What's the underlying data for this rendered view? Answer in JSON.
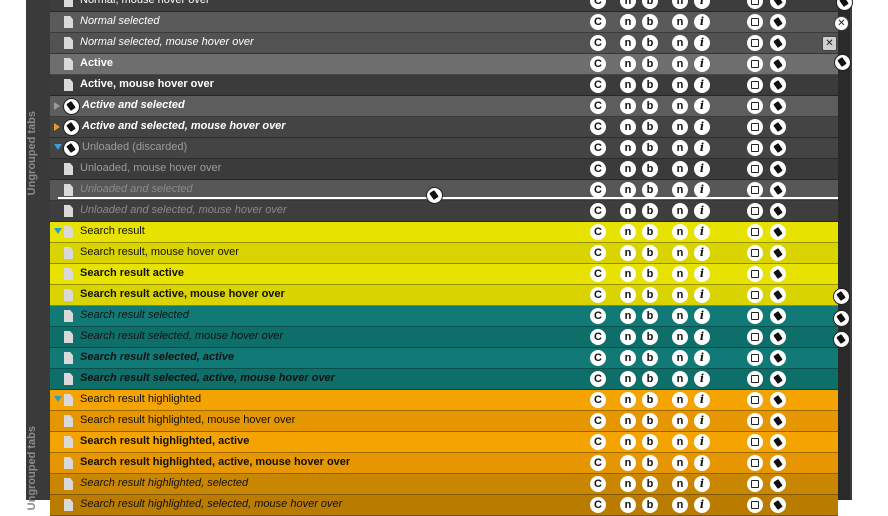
{
  "sidebar": {
    "top_label": "Ungrouped tabs",
    "bottom_label": "Ungrouped tabs"
  },
  "tab_icons": {
    "c": "C",
    "n": "n",
    "b": "b",
    "i": "i"
  },
  "rows": [
    {
      "label": "Normal, mouse hover over",
      "bg": "#3d3d3d",
      "color": "#ffffff",
      "bold": false,
      "italic": false,
      "icon": "doc"
    },
    {
      "label": "Normal selected",
      "bg": "#5a5a5a",
      "color": "#ffffff",
      "bold": false,
      "italic": true,
      "icon": "doc"
    },
    {
      "label": "Normal selected, mouse hover over",
      "bg": "#525252",
      "color": "#ffffff",
      "bold": false,
      "italic": true,
      "icon": "doc"
    },
    {
      "label": "Active",
      "bg": "#6e6e6e",
      "color": "#ffffff",
      "bold": true,
      "italic": false,
      "icon": "doc"
    },
    {
      "label": "Active, mouse hover over",
      "bg": "#3b3b3b",
      "color": "#ffffff",
      "bold": true,
      "italic": false,
      "icon": "doc"
    },
    {
      "label": "Active and selected",
      "bg": "#5d5d5d",
      "color": "#ffffff",
      "bold": true,
      "italic": true,
      "icon": "sound",
      "twisty": "right",
      "twisty_color": "#9a9a9a"
    },
    {
      "label": "Active and selected, mouse hover over",
      "bg": "#444444",
      "color": "#ffffff",
      "bold": true,
      "italic": true,
      "icon": "sound",
      "twisty": "right",
      "twisty_color": "#e59a2b"
    },
    {
      "label": "Unloaded (discarded)",
      "bg": "#444444",
      "color": "#9c9c9c",
      "bold": false,
      "italic": false,
      "icon": "sound",
      "twisty": "down",
      "twisty_color": "#3c9fd6"
    },
    {
      "label": "Unloaded, mouse hover over",
      "bg": "#3b3b3b",
      "color": "#9c9c9c",
      "bold": false,
      "italic": false,
      "icon": "doc"
    },
    {
      "label": "Unloaded and selected",
      "bg": "#575757",
      "color": "#8a8a8a",
      "bold": false,
      "italic": true,
      "icon": "doc"
    },
    {
      "label": "Unloaded and selected, mouse hover over",
      "bg": "#3e3e3e",
      "color": "#8a8a8a",
      "bold": false,
      "italic": true,
      "icon": "doc"
    },
    {
      "label": "Search result",
      "bg": "#e8e200",
      "color": "#111111",
      "bold": false,
      "italic": false,
      "icon": "doc",
      "twisty": "down",
      "twisty_color": "#26a0c8"
    },
    {
      "label": "Search result, mouse hover over",
      "bg": "#d9d400",
      "color": "#111111",
      "bold": false,
      "italic": false,
      "icon": "doc"
    },
    {
      "label": "Search result active",
      "bg": "#e8e200",
      "color": "#111111",
      "bold": true,
      "italic": false,
      "icon": "doc"
    },
    {
      "label": "Search result active, mouse hover over",
      "bg": "#d9d400",
      "color": "#111111",
      "bold": true,
      "italic": false,
      "icon": "doc"
    },
    {
      "label": "Search result selected",
      "bg": "#117a76",
      "color": "#111111",
      "bold": false,
      "italic": true,
      "icon": "doc"
    },
    {
      "label": "Search result selected, mouse hover over",
      "bg": "#0e6e6a",
      "color": "#111111",
      "bold": false,
      "italic": true,
      "icon": "doc"
    },
    {
      "label": "Search result selected, active",
      "bg": "#117a76",
      "color": "#111111",
      "bold": true,
      "italic": true,
      "icon": "doc"
    },
    {
      "label": "Search result selected, active, mouse hover over",
      "bg": "#0e6e6a",
      "color": "#111111",
      "bold": true,
      "italic": true,
      "icon": "doc"
    },
    {
      "label": "Search result highlighted",
      "bg": "#f5a300",
      "color": "#111111",
      "bold": false,
      "italic": false,
      "icon": "doc",
      "twisty": "down",
      "twisty_color": "#26a0c8"
    },
    {
      "label": "Search result highlighted, mouse hover over",
      "bg": "#e69600",
      "color": "#111111",
      "bold": false,
      "italic": false,
      "icon": "doc"
    },
    {
      "label": "Search result highlighted, active",
      "bg": "#f5a300",
      "color": "#111111",
      "bold": true,
      "italic": false,
      "icon": "doc"
    },
    {
      "label": "Search result highlighted, active, mouse hover over",
      "bg": "#e69600",
      "color": "#111111",
      "bold": true,
      "italic": false,
      "icon": "doc"
    },
    {
      "label": "Search result highlighted, selected",
      "bg": "#c98600",
      "color": "#111111",
      "bold": false,
      "italic": true,
      "icon": "doc"
    },
    {
      "label": "Search result highlighted, selected, mouse hover over",
      "bg": "#ba7c00",
      "color": "#111111",
      "bold": false,
      "italic": true,
      "icon": "doc"
    }
  ]
}
